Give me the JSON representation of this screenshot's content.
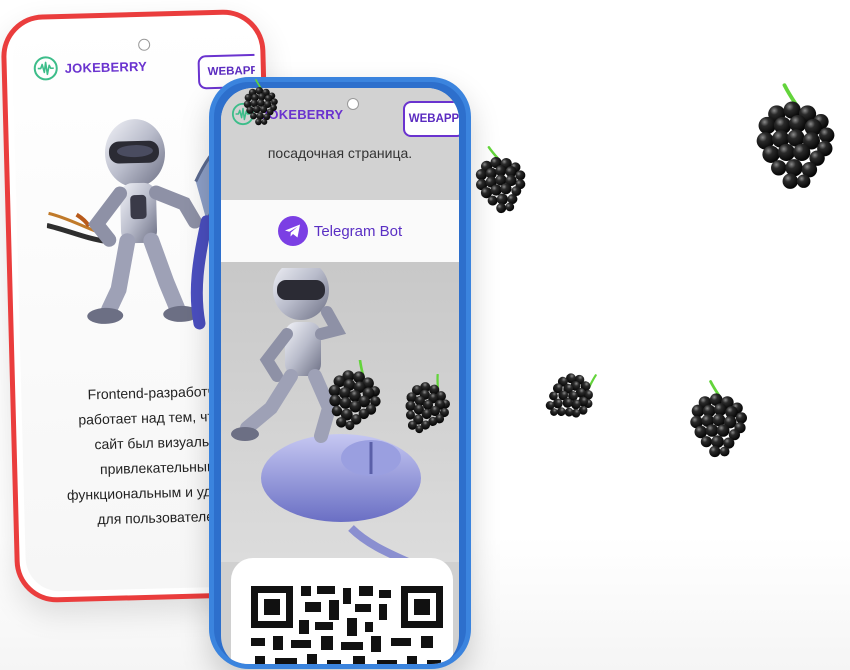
{
  "brand": {
    "name": "JOKEBERRY"
  },
  "header": {
    "webapp_label": "WEBAPP"
  },
  "back_phone": {
    "text_lines": [
      "Frontend-разработчик",
      "работает над тем, чтобы",
      "сайт был визуально",
      "привлекательным,",
      "функциональным и удобным",
      "для пользователей."
    ]
  },
  "front_phone": {
    "tagline": "посадочная страница.",
    "telegram_label": "Telegram Bot"
  },
  "icons": {
    "logo": "sound-wave-icon",
    "telegram": "telegram-icon",
    "berry": "blackberry-icon",
    "qr": "qr-code"
  },
  "colors": {
    "back_phone_frame": "#ea3d3d",
    "front_phone_frame": "#3b84de",
    "brand_text": "#6a33cf",
    "logo_green": "#3dbd8a",
    "telegram": "#7b3fe4"
  }
}
